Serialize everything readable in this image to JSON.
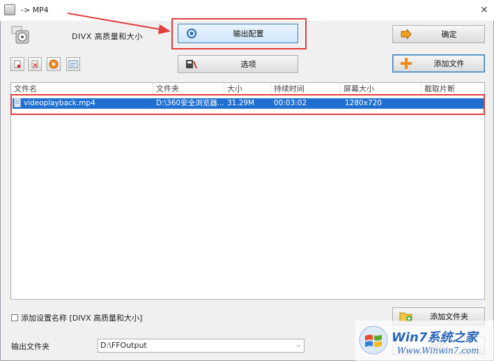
{
  "window": {
    "title": "-> MP4",
    "close": "×"
  },
  "profile": {
    "label": "DIVX 高质量和大小"
  },
  "buttons": {
    "output_config": "输出配置",
    "confirm": "确定",
    "options": "选项",
    "add_file": "添加文件",
    "add_folder": "添加文件夹",
    "bottom_right": "确定"
  },
  "table": {
    "headers": [
      "文件名",
      "文件夹",
      "大小",
      "持续时间",
      "屏幕大小",
      "截取片断"
    ],
    "rows": [
      {
        "name": "videoplayback.mp4",
        "folder": "D:\\360安全浏览器...",
        "size": "31.29M",
        "duration": "00:03:02",
        "resolution": "1280x720",
        "clip": ""
      }
    ]
  },
  "footer": {
    "checkbox_label": "添加设置名称 [DIVX 高质量和大小]",
    "output_folder_label": "输出文件夹",
    "output_folder_value": "D:\\FFOutput"
  },
  "watermark": {
    "brand": "Win7系统之家",
    "url": "Www.Winwin7.com"
  },
  "colors": {
    "selection": "#1f6fd1",
    "highlight_box": "#e23c3c",
    "accent": "#3c7fb1"
  }
}
